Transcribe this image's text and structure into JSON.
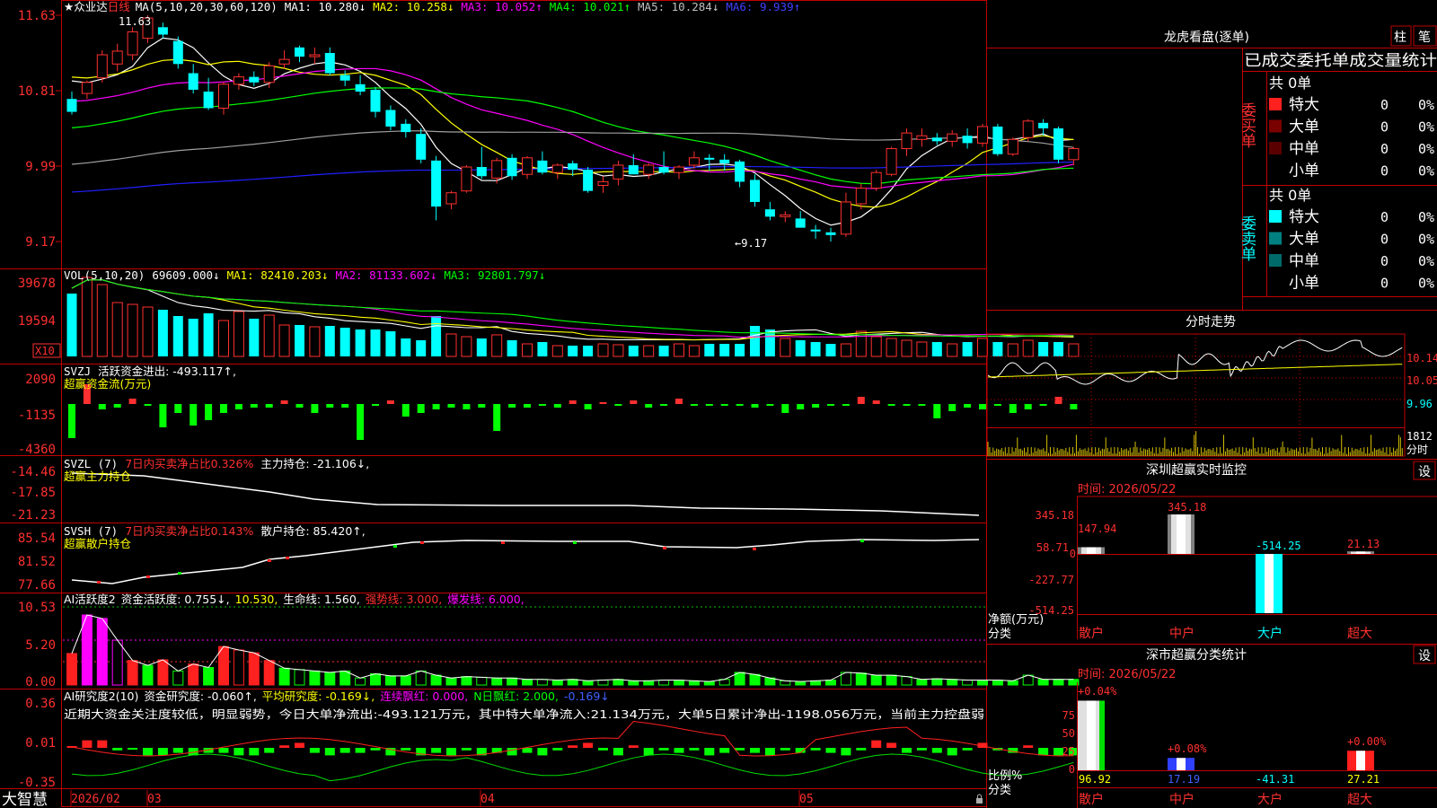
{
  "colors": {
    "up": "#ff3030",
    "down": "#00ffff",
    "axis": "#c00000",
    "ma1": "#ffffff",
    "ma2": "#ffff00",
    "ma3": "#ff00ff",
    "ma4": "#00ff00",
    "ma5": "#a0a0a0",
    "ma6": "#2020ff",
    "cyan": "#00ffff",
    "green": "#00ff00",
    "yellow": "#ffff00",
    "magenta": "#ff00ff",
    "red": "#ff2020"
  },
  "main": {
    "stock_name": "★众业达",
    "period": "日线",
    "ma_label": "MA(5,10,20,30,60,120)",
    "ma1": "MA1: 10.280↓",
    "ma2": "MA2: 10.258↓",
    "ma3": "MA3: 10.052↑",
    "ma4": "MA4: 10.021↑",
    "ma5": "MA5: 10.284↓",
    "ma6": "MA6: 9.939↑",
    "y_ticks": [
      "11.63",
      "10.81",
      "9.99",
      "9.17"
    ],
    "high_mark": "11.63",
    "low_mark": "←9.17"
  },
  "vol": {
    "label": "VOL(5,10,20)",
    "value": "69609.000↓",
    "ma1": "MA1: 82410.203↓",
    "ma2": "MA2: 81133.602↓",
    "ma3": "MA3: 92801.797↓",
    "y_ticks": [
      "39678",
      "19594"
    ],
    "unit": "X10"
  },
  "svzj": {
    "label": "SVZJ",
    "l1": "活跃资金进出: -493.117↑,",
    "l2": "超赢资金流(万元)",
    "y_ticks": [
      "2090",
      "-1135",
      "-4360"
    ]
  },
  "svzl": {
    "label": "SVZL (7)",
    "p1": "7日内买卖净占比0.326%",
    "p2": "主力持仓: -21.106↓,",
    "l2": "超赢主力持仓",
    "y_ticks": [
      "-14.46",
      "-17.85",
      "-21.23"
    ]
  },
  "svsh": {
    "label": "SVSH (7)",
    "p1": "7日内买卖净占比0.143%",
    "p2": "散户持仓: 85.420↑,",
    "l2": "超赢散户持仓",
    "y_ticks": [
      "85.54",
      "81.52",
      "77.66"
    ]
  },
  "ai1": {
    "label": "AI活跃度2",
    "p1": "资金活跃度: 0.755↓,",
    "p2": "10.530,",
    "p3": "生命线: 1.560,",
    "p4": "强势线: 3.000,",
    "p5": "爆发线: 6.000,",
    "y_ticks": [
      "10.53",
      "5.20",
      "0.00"
    ]
  },
  "ai2": {
    "label": "AI研究度2(10)",
    "p1": "资金研究度: -0.060↑,",
    "p2": "平均研究度: -0.169↓,",
    "p3": "连续飘红: 0.000,",
    "p4": "N日飘红: 2.000,",
    "p5": "-0.169↓",
    "note": "近期大资金关注度较低，明显弱势，今日大单净流出:-493.121万元，其中特大单净流入:21.134万元，大单5日累计净出-1198.056万元，当前主力控盘弱",
    "y_ticks": [
      "0.36",
      "0.01",
      "-0.35"
    ]
  },
  "bottom": {
    "brand": "大智慧",
    "d1": "2026/02",
    "d2": "03",
    "d3": "04",
    "d4": "05"
  },
  "right": {
    "lhkp": {
      "title": "龙虎看盘(逐单)",
      "btn1": "柱",
      "btn2": "笔",
      "tabs": "已成交委托单成交量统计",
      "buy_label": "委买单",
      "buy_total": "共 0单",
      "sell_label": "委卖单",
      "sell_total": "共 0单",
      "buy_rows": [
        {
          "name": "特大",
          "count": "0",
          "pct": "0%"
        },
        {
          "name": "大单",
          "count": "0",
          "pct": "0%"
        },
        {
          "name": "中单",
          "count": "0",
          "pct": "0%"
        },
        {
          "name": "小单",
          "count": "0",
          "pct": "0%"
        }
      ],
      "sell_rows": [
        {
          "name": "特大",
          "count": "0",
          "pct": "0%"
        },
        {
          "name": "大单",
          "count": "0",
          "pct": "0%"
        },
        {
          "name": "中单",
          "count": "0",
          "pct": "0%"
        },
        {
          "name": "小单",
          "count": "0",
          "pct": "0%"
        }
      ]
    },
    "fenshi": {
      "title": "分时走势",
      "y_ticks": [
        "10.14",
        "10.05",
        "9.96"
      ],
      "vol_tick": "1812",
      "footer": "分时"
    },
    "szmon": {
      "title": "深圳超赢实时监控",
      "btn": "设",
      "time": "时间: 2026/05/22",
      "y_ticks": [
        "345.18",
        "58.71",
        "0",
        "-227.77",
        "-514.25"
      ],
      "ylabel": "净额(万元)",
      "xlabel": "分类",
      "cats": [
        "散户",
        "中户",
        "大户",
        "超大"
      ],
      "values": [
        58.71,
        345.18,
        -514.25,
        21.13
      ],
      "val_labels": [
        "147.94",
        "345.18",
        "-514.25",
        "21.13"
      ]
    },
    "szcls": {
      "title": "深市超赢分类统计",
      "btn": "设",
      "time": "时间: 2026/05/22",
      "y_ticks": [
        "75",
        "50",
        "25",
        "0"
      ],
      "ylabel": "比例%",
      "xlabel": "分类",
      "cats": [
        "散户",
        "中户",
        "大户",
        "超大"
      ],
      "top_labels": [
        "+0.04%",
        "+0.08%",
        "",
        "+0.00%"
      ],
      "bottom_vals": [
        "96.92",
        "17.19",
        "-41.31",
        "27.21"
      ],
      "values": [
        96.92,
        17.19,
        0,
        27.21
      ]
    }
  },
  "chart_data": {
    "type": "candlestick",
    "title": "众业达 日线",
    "x_start_label": "2026/02",
    "ylim": [
      9.17,
      11.63
    ],
    "ohlc": [
      [
        10.72,
        10.8,
        10.55,
        10.58
      ],
      [
        10.78,
        10.92,
        10.72,
        10.9
      ],
      [
        10.95,
        11.25,
        10.9,
        11.2
      ],
      [
        11.1,
        11.32,
        11.02,
        11.24
      ],
      [
        11.2,
        11.5,
        11.14,
        11.45
      ],
      [
        11.38,
        11.63,
        11.33,
        11.6
      ],
      [
        11.5,
        11.55,
        11.38,
        11.42
      ],
      [
        11.35,
        11.4,
        11.05,
        11.1
      ],
      [
        11.0,
        11.1,
        10.78,
        10.82
      ],
      [
        10.8,
        10.95,
        10.6,
        10.62
      ],
      [
        10.62,
        10.9,
        10.55,
        10.88
      ],
      [
        10.88,
        11.0,
        10.82,
        10.96
      ],
      [
        10.96,
        11.02,
        10.86,
        10.9
      ],
      [
        10.9,
        11.12,
        10.84,
        11.08
      ],
      [
        11.1,
        11.25,
        11.05,
        11.15
      ],
      [
        11.28,
        11.3,
        11.12,
        11.18
      ],
      [
        11.18,
        11.28,
        11.1,
        11.2
      ],
      [
        11.22,
        11.28,
        10.98,
        11.0
      ],
      [
        10.98,
        11.03,
        10.86,
        10.92
      ],
      [
        10.88,
        10.98,
        10.76,
        10.8
      ],
      [
        10.82,
        10.85,
        10.52,
        10.58
      ],
      [
        10.6,
        10.65,
        10.38,
        10.42
      ],
      [
        10.45,
        10.5,
        10.3,
        10.36
      ],
      [
        10.34,
        10.4,
        10.02,
        10.06
      ],
      [
        10.05,
        10.1,
        9.4,
        9.55
      ],
      [
        9.58,
        9.72,
        9.52,
        9.7
      ],
      [
        9.72,
        10.0,
        9.7,
        9.98
      ],
      [
        9.98,
        10.2,
        9.85,
        9.88
      ],
      [
        9.86,
        10.08,
        9.8,
        10.05
      ],
      [
        10.08,
        10.12,
        9.84,
        9.88
      ],
      [
        9.9,
        10.1,
        9.85,
        10.08
      ],
      [
        10.05,
        10.15,
        9.9,
        9.92
      ],
      [
        9.92,
        10.02,
        9.85,
        10.0
      ],
      [
        10.02,
        10.05,
        9.88,
        9.95
      ],
      [
        9.95,
        9.98,
        9.7,
        9.72
      ],
      [
        9.78,
        9.88,
        9.7,
        9.82
      ],
      [
        9.85,
        10.05,
        9.78,
        10.0
      ],
      [
        10.0,
        10.12,
        9.9,
        9.9
      ],
      [
        9.9,
        10.02,
        9.85,
        10.0
      ],
      [
        9.98,
        10.15,
        9.9,
        9.92
      ],
      [
        9.92,
        10.0,
        9.85,
        9.98
      ],
      [
        10.0,
        10.15,
        9.96,
        10.08
      ],
      [
        10.08,
        10.12,
        9.94,
        10.06
      ],
      [
        10.06,
        10.12,
        9.94,
        10.02
      ],
      [
        10.04,
        10.06,
        9.76,
        9.82
      ],
      [
        9.84,
        9.9,
        9.55,
        9.6
      ],
      [
        9.52,
        9.6,
        9.4,
        9.44
      ],
      [
        9.44,
        9.5,
        9.38,
        9.46
      ],
      [
        9.42,
        9.5,
        9.34,
        9.32
      ],
      [
        9.3,
        9.35,
        9.2,
        9.28
      ],
      [
        9.27,
        9.32,
        9.17,
        9.24
      ],
      [
        9.25,
        9.7,
        9.22,
        9.6
      ],
      [
        9.58,
        9.8,
        9.52,
        9.75
      ],
      [
        9.75,
        9.95,
        9.72,
        9.92
      ],
      [
        9.9,
        10.2,
        9.88,
        10.18
      ],
      [
        10.18,
        10.4,
        10.1,
        10.35
      ],
      [
        10.28,
        10.4,
        10.2,
        10.32
      ],
      [
        10.3,
        10.35,
        10.22,
        10.26
      ],
      [
        10.26,
        10.38,
        10.2,
        10.34
      ],
      [
        10.32,
        10.4,
        10.18,
        10.24
      ],
      [
        10.24,
        10.45,
        10.2,
        10.42
      ],
      [
        10.42,
        10.45,
        10.1,
        10.12
      ],
      [
        10.12,
        10.3,
        10.1,
        10.28
      ],
      [
        10.3,
        10.5,
        10.26,
        10.48
      ],
      [
        10.46,
        10.5,
        10.32,
        10.4
      ],
      [
        10.4,
        10.42,
        10.02,
        10.06
      ],
      [
        10.06,
        10.2,
        10.0,
        10.18
      ]
    ]
  }
}
